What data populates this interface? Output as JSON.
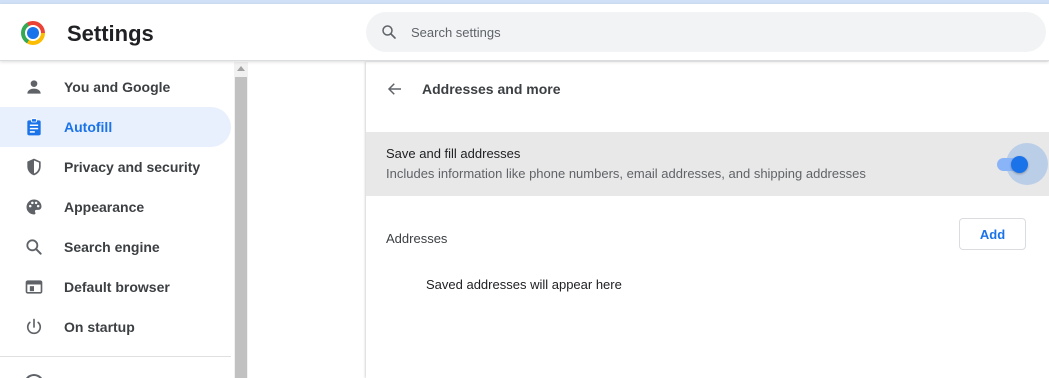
{
  "app": {
    "title": "Settings"
  },
  "search": {
    "placeholder": "Search settings",
    "value": ""
  },
  "sidebar": {
    "items": [
      {
        "label": "You and Google",
        "icon": "person-icon",
        "active": false
      },
      {
        "label": "Autofill",
        "icon": "clipboard-icon",
        "active": true
      },
      {
        "label": "Privacy and security",
        "icon": "shield-icon",
        "active": false
      },
      {
        "label": "Appearance",
        "icon": "palette-icon",
        "active": false
      },
      {
        "label": "Search engine",
        "icon": "search-icon",
        "active": false
      },
      {
        "label": "Default browser",
        "icon": "browser-window-icon",
        "active": false
      },
      {
        "label": "On startup",
        "icon": "power-icon",
        "active": false
      }
    ]
  },
  "page": {
    "title": "Addresses and more",
    "save_toggle": {
      "title": "Save and fill addresses",
      "description": "Includes information like phone numbers, email addresses, and shipping addresses",
      "enabled": true
    },
    "addresses": {
      "label": "Addresses",
      "add_label": "Add",
      "empty_text": "Saved addresses will appear here"
    }
  },
  "colors": {
    "accent": "#1a73e8",
    "active_nav_bg": "#e8f0fe",
    "toggle_track": "#8ab4f8",
    "row_highlight": "#e8e8e8"
  }
}
